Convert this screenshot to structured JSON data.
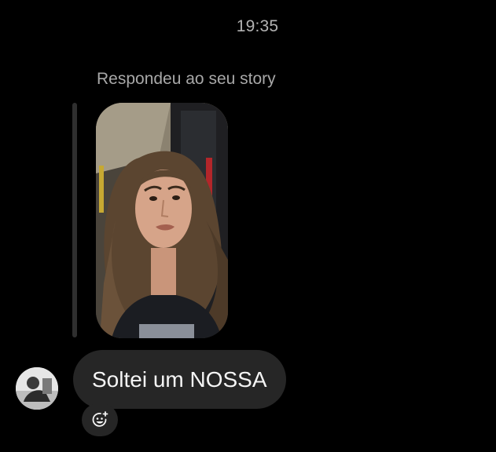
{
  "thread": {
    "timestamp": "19:35",
    "story_reply_caption": "Respondeu ao seu story",
    "message_text": "Soltei um NOSSA"
  },
  "story_preview": {
    "content": "selfie-photo"
  },
  "sender": {
    "avatar": "profile-photo"
  },
  "actions": {
    "reaction_icon": "add-emoji-reaction-icon"
  },
  "colors": {
    "background": "#000000",
    "bubble": "#262626",
    "message_text": "#f5f5f5",
    "secondary_text": "#a8a8a8",
    "reply_bar": "#2f2f2f"
  }
}
